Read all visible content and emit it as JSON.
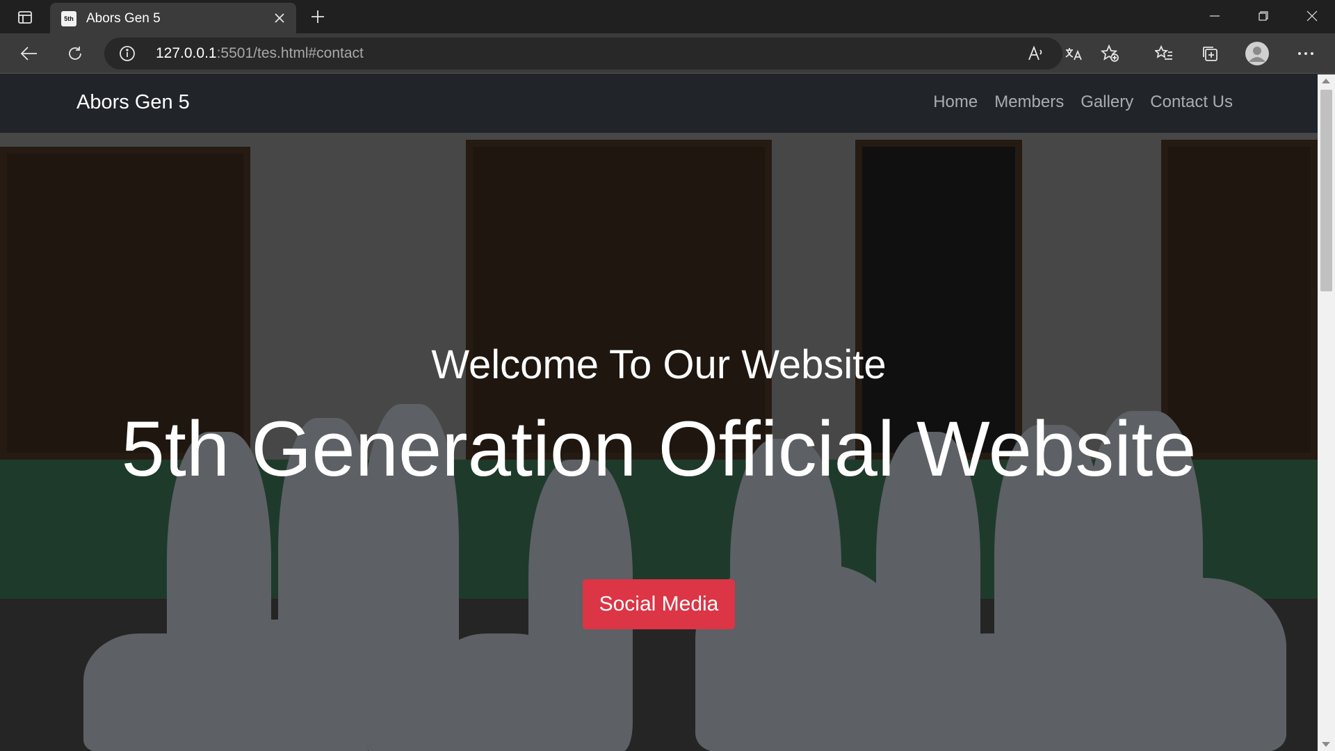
{
  "browser": {
    "tab_title": "Abors Gen 5",
    "favicon_text": "5th",
    "url_host": "127.0.0.1",
    "url_rest": ":5501/tes.html#contact"
  },
  "page": {
    "brand": "Abors Gen 5",
    "nav": [
      "Home",
      "Members",
      "Gallery",
      "Contact Us"
    ],
    "hero": {
      "subtitle": "Welcome To Our Website",
      "title": "5th Generation Official Website",
      "cta_label": "Social Media"
    }
  },
  "colors": {
    "navbar": "#212529",
    "cta": "#dc3545"
  }
}
